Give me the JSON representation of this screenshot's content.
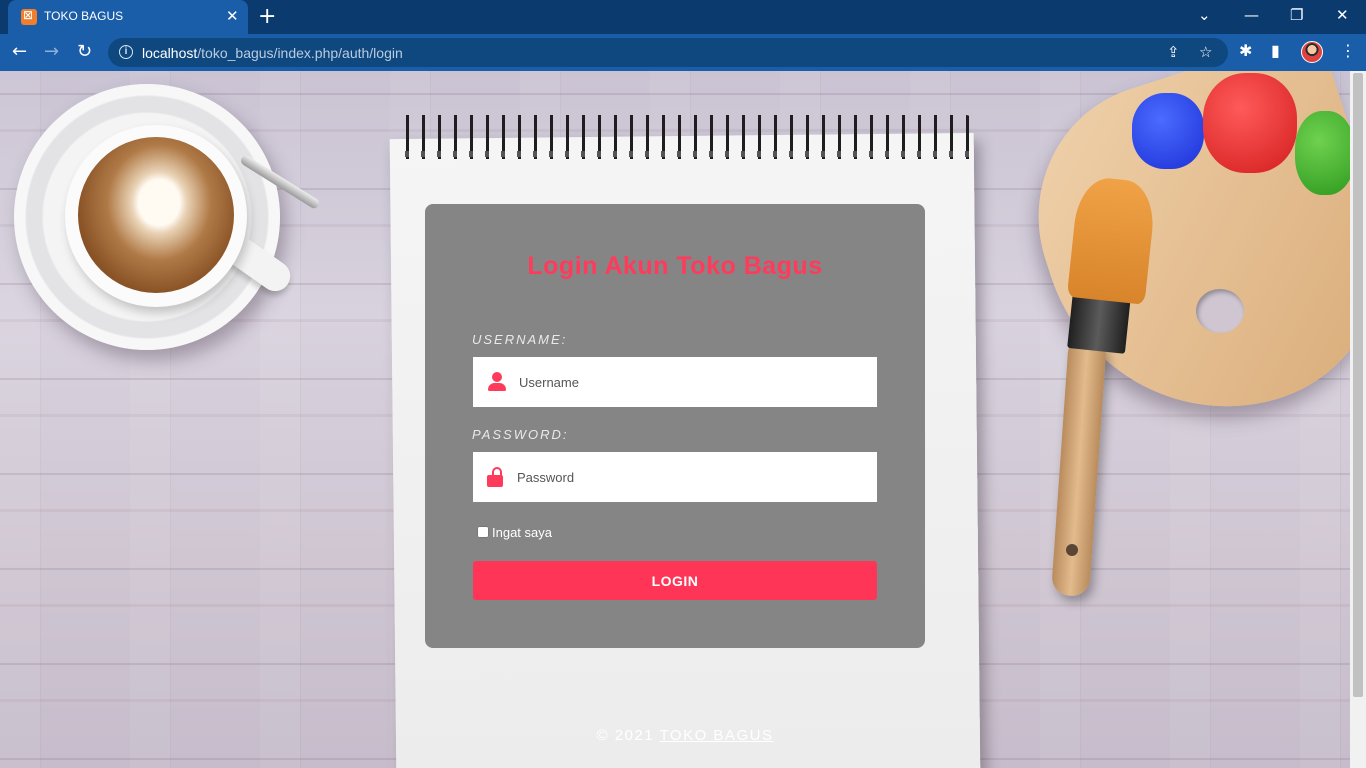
{
  "browser": {
    "tab_title": "TOKO BAGUS",
    "url_host": "localhost",
    "url_path": "/toko_bagus/index.php/auth/login",
    "accent_color": "#1a5da8"
  },
  "page": {
    "title": "Login Akun Toko Bagus",
    "username_label": "USERNAME:",
    "username_placeholder": "Username",
    "password_label": "PASSWORD:",
    "password_placeholder": "Password",
    "remember_label": "Ingat saya",
    "login_button": "LOGIN",
    "footer_prefix": "© 2021",
    "footer_link": "TOKO BAGUS",
    "brand_color": "#ff3b5c"
  }
}
